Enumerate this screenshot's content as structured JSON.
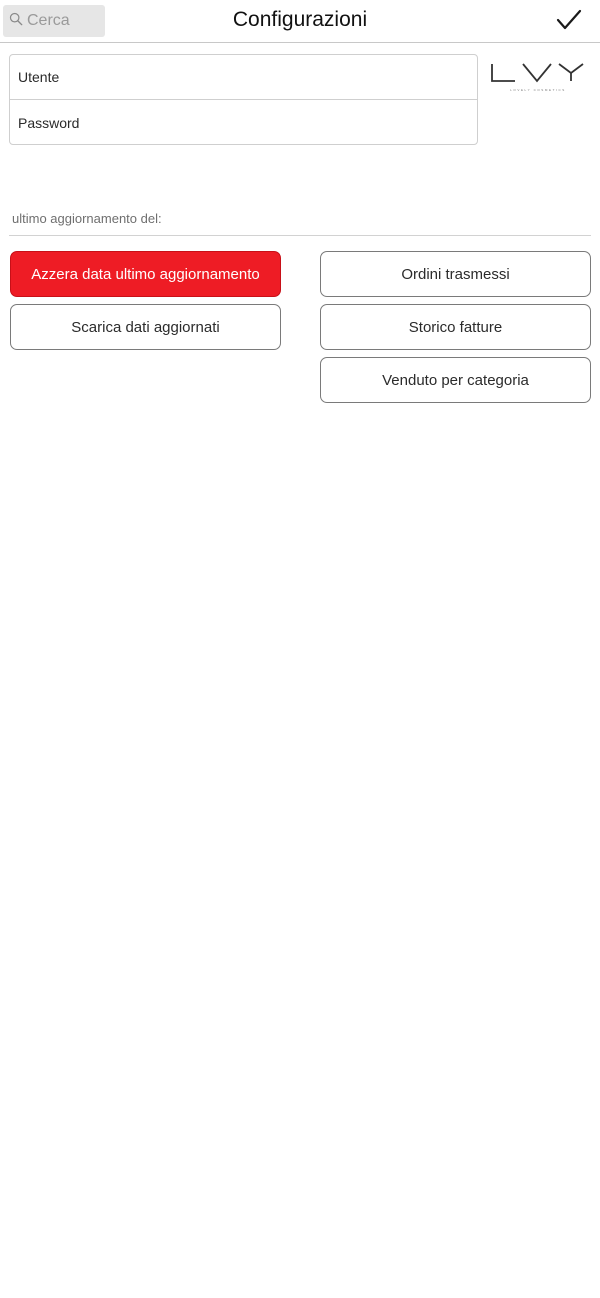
{
  "header": {
    "search": {
      "placeholder": "Cerca",
      "icon": "search-icon"
    },
    "title": "Configurazioni",
    "confirm_icon": "checkmark-icon"
  },
  "credentials": {
    "user_placeholder": "Utente",
    "password_placeholder": "Password"
  },
  "logo": {
    "text": "LVY",
    "subtitle": "LOVELY COSMETICS"
  },
  "last_update": {
    "label": "ultimo aggiornamento del:"
  },
  "buttons": {
    "reset_label": "Azzera data ultimo aggiornamento",
    "download_label": "Scarica dati aggiornati",
    "orders_label": "Ordini trasmessi",
    "invoices_label": "Storico fatture",
    "sold_label": "Venduto per categoria"
  },
  "colors": {
    "accent_red": "#ee1c25",
    "search_bg": "#e6e6e6",
    "border": "#7a7a7a"
  }
}
